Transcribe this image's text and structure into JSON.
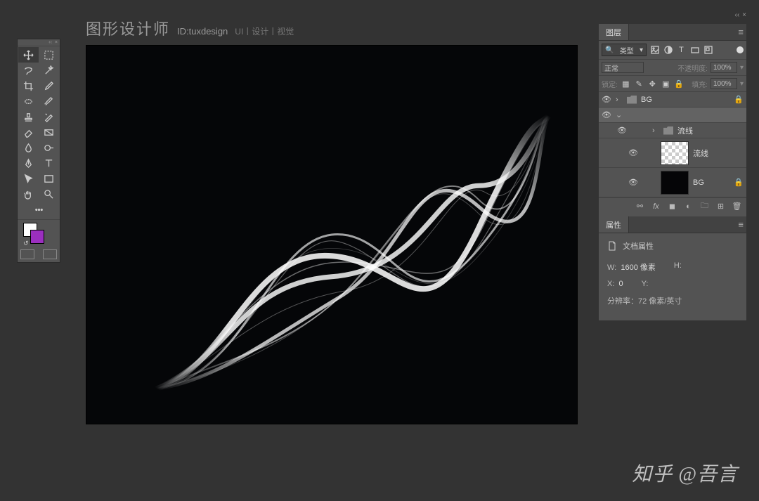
{
  "title": {
    "main": "图形设计师",
    "id": "ID:tuxdesign",
    "tags": "UI丨设计丨视觉"
  },
  "layersPanel": {
    "tab": "图层",
    "filter": "类型",
    "blend": "正常",
    "opacityLabel": "不透明度:",
    "opacityVal": "100%",
    "lockLabel": "锁定:",
    "fillLabel": "填充:",
    "fillVal": "100%",
    "items": [
      {
        "name": "BG"
      },
      {
        "name": ""
      },
      {
        "name": "流线"
      },
      {
        "name": "流线"
      },
      {
        "name": "BG"
      }
    ]
  },
  "propsPanel": {
    "tab": "属性",
    "docTitle": "文档属性",
    "w_label": "W:",
    "w_val": "1600 像素",
    "h_label": "H:",
    "x_label": "X:",
    "x_val": "0",
    "y_label": "Y:",
    "res": "分辨率：72 像素/英寸"
  },
  "watermark": "知乎 @吾言"
}
